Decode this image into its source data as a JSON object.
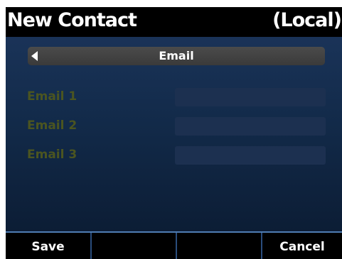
{
  "title": {
    "left": "New Contact",
    "right": "(Local)"
  },
  "section": {
    "label": "Email",
    "nav_icon": "left-arrow-icon"
  },
  "fields": [
    {
      "label": "Email 1",
      "value": ""
    },
    {
      "label": "Email 2",
      "value": ""
    },
    {
      "label": "Email 3",
      "value": ""
    }
  ],
  "softkeys": [
    {
      "label": "Save"
    },
    {
      "label": ""
    },
    {
      "label": ""
    },
    {
      "label": "Cancel"
    }
  ],
  "colors": {
    "background": "#122a49",
    "field_label": "#4b5520",
    "softkey_border": "#4f7db3"
  }
}
